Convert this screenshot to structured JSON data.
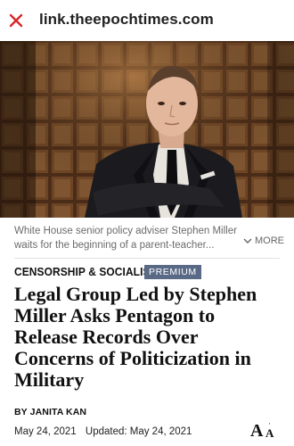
{
  "browser": {
    "url": "link.theepochtimes.com",
    "close_icon": "close-icon",
    "close_color": "#d9262b"
  },
  "hero": {
    "caption_line1": "White House senior policy adviser Stephen Miller",
    "caption_line2": "waits for the beginning of a parent-teacher...",
    "more_label": "MORE",
    "more_icon": "chevron-down-icon"
  },
  "article": {
    "category": "CENSORSHIP & SOCIALISM",
    "badge": "PREMIUM",
    "badge_color": "#5a6a86",
    "headline_lines": [
      "Legal Group Led by Stephen",
      "Miller Asks Pentagon to",
      "Release Records Over",
      "Concerns of Politicization in",
      "Military"
    ],
    "byline_prefix": "BY",
    "author": "JANITA KAN",
    "published": "May 24, 2021",
    "updated": "Updated: May 24, 2021",
    "font_size_icon": "font-size-icon"
  }
}
